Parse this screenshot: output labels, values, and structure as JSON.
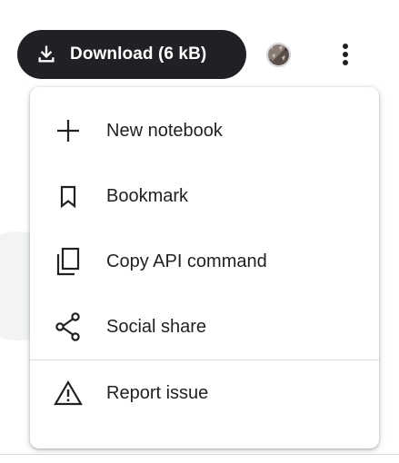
{
  "toolbar": {
    "download_label": "Download (6 kB)",
    "download_icon": "download-icon",
    "avatar_icon": "user-avatar",
    "more_icon": "more-vert-icon"
  },
  "menu": {
    "items": [
      {
        "label": "New notebook",
        "icon": "plus-icon"
      },
      {
        "label": "Bookmark",
        "icon": "bookmark-icon"
      },
      {
        "label": "Copy API command",
        "icon": "copy-icon"
      },
      {
        "label": "Social share",
        "icon": "share-icon"
      },
      {
        "label": "Report issue",
        "icon": "warning-icon"
      }
    ]
  },
  "colors": {
    "button_bg": "#202124",
    "button_text": "#ffffff",
    "menu_text": "#202124",
    "icon": "#202124"
  }
}
